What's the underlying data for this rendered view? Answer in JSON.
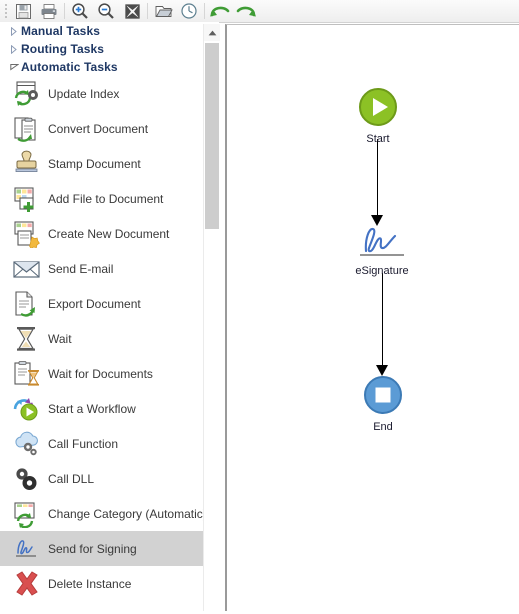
{
  "toolbar": {
    "buttons": [
      {
        "name": "save-icon",
        "title": "Save"
      },
      {
        "name": "print-icon",
        "title": "Print"
      },
      {
        "name": "zoom-in-icon",
        "title": "Zoom In"
      },
      {
        "name": "zoom-out-icon",
        "title": "Zoom Out"
      },
      {
        "name": "fit-to-screen-icon",
        "title": "Fit to Screen"
      },
      {
        "name": "open-folder-icon",
        "title": "Open"
      },
      {
        "name": "history-clock-icon",
        "title": "History"
      },
      {
        "name": "undo-icon",
        "title": "Undo"
      },
      {
        "name": "redo-icon",
        "title": "Redo"
      }
    ]
  },
  "sidebar": {
    "groups": [
      {
        "label": "Manual Tasks",
        "expanded": false
      },
      {
        "label": "Routing Tasks",
        "expanded": false
      },
      {
        "label": "Automatic Tasks",
        "expanded": true
      }
    ],
    "items": [
      {
        "label": "Update Index",
        "icon": "update-index-icon",
        "selected": false
      },
      {
        "label": "Convert Document",
        "icon": "convert-document-icon",
        "selected": false
      },
      {
        "label": "Stamp Document",
        "icon": "stamp-document-icon",
        "selected": false
      },
      {
        "label": "Add File to Document",
        "icon": "add-file-to-document-icon",
        "selected": false
      },
      {
        "label": "Create New Document",
        "icon": "create-new-document-icon",
        "selected": false
      },
      {
        "label": "Send E-mail",
        "icon": "send-email-icon",
        "selected": false
      },
      {
        "label": "Export Document",
        "icon": "export-document-icon",
        "selected": false
      },
      {
        "label": "Wait",
        "icon": "wait-hourglass-icon",
        "selected": false
      },
      {
        "label": "Wait for Documents",
        "icon": "wait-for-documents-icon",
        "selected": false
      },
      {
        "label": "Start a Workflow",
        "icon": "start-workflow-icon",
        "selected": false
      },
      {
        "label": "Call Function",
        "icon": "call-function-icon",
        "selected": false
      },
      {
        "label": "Call DLL",
        "icon": "call-dll-icon",
        "selected": false
      },
      {
        "label": "Change Category (Automatic)",
        "icon": "change-category-icon",
        "selected": false
      },
      {
        "label": "Send for Signing",
        "icon": "send-for-signing-icon",
        "selected": true
      },
      {
        "label": "Delete Instance",
        "icon": "delete-instance-icon",
        "selected": false
      }
    ]
  },
  "canvas": {
    "nodes": [
      {
        "id": "start",
        "label": "Start",
        "type": "start",
        "color": "#8CC125"
      },
      {
        "id": "esignature",
        "label": "eSignature",
        "type": "signature",
        "color": "#4472C4"
      },
      {
        "id": "end",
        "label": "End",
        "type": "end",
        "color": "#5B9BD5"
      }
    ],
    "connections": [
      {
        "from": "start",
        "to": "esignature"
      },
      {
        "from": "esignature",
        "to": "end"
      }
    ]
  }
}
